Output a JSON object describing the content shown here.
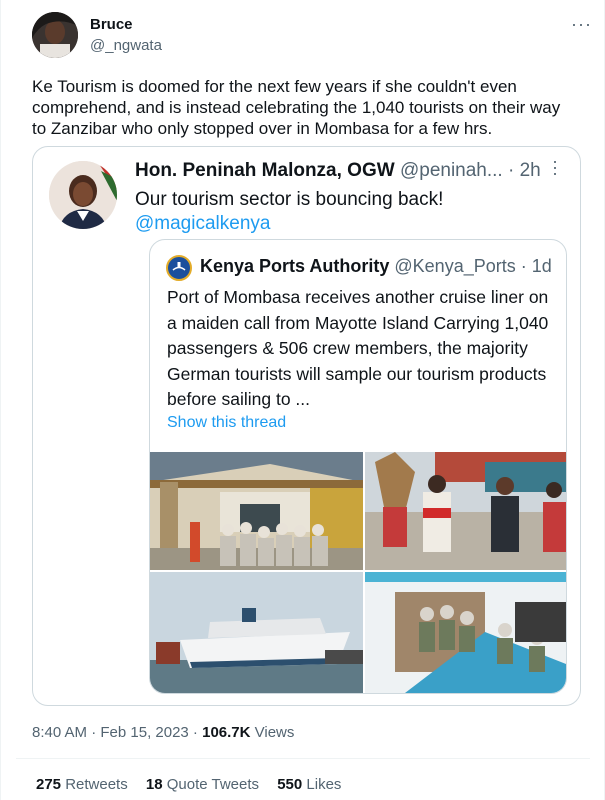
{
  "author": {
    "name": "Bruce",
    "handle": "@_ngwata"
  },
  "more_icon": "more-horizontal-icon",
  "tweet": {
    "text": "Ke Tourism is doomed for the next few years if she couldn't even comprehend, and is instead celebrating the 1,040 tourists on their way to Zanzibar who only stopped over in Mombasa for a few hrs."
  },
  "quote1": {
    "name": "Hon. Peninah Malonza, OGW",
    "handle": "@peninah...",
    "time": "· 2h",
    "text": "Our tourism sector is bouncing back!",
    "mention": "@magicalkenya"
  },
  "quote2": {
    "name": "Kenya Ports Authority",
    "handle": "@Kenya_Ports",
    "time": "· 1d",
    "text": "Port of Mombasa receives another cruise liner on a maiden call from Mayotte Island Carrying 1,040 passengers & 506 crew members, the majority German tourists will sample our tourism products before sailing to ...",
    "show_thread": "Show this thread",
    "photos": [
      "port-terminal-tourists-photo",
      "cultural-dancers-welcome-photo",
      "cruise-ship-photo",
      "passengers-disembarking-photo"
    ]
  },
  "meta": {
    "time": "8:40 AM · Feb 15, 2023 · ",
    "views_count": "106.7K",
    "views_label": " Views"
  },
  "stats": {
    "retweets_count": "275",
    "retweets_label": " Retweets",
    "quotes_count": "18",
    "quotes_label": " Quote Tweets",
    "likes_count": "550",
    "likes_label": " Likes"
  },
  "colors": {
    "accent": "#1d9bf0",
    "secondary_text": "#536471",
    "border": "#cfd9de"
  }
}
